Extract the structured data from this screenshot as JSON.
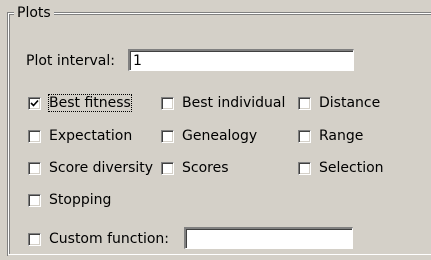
{
  "group": {
    "title": "Plots"
  },
  "plot_interval": {
    "label": "Plot interval:",
    "value": "1"
  },
  "checkboxes": [
    {
      "label": "Best fitness",
      "checked": true
    },
    {
      "label": "Best individual",
      "checked": false
    },
    {
      "label": "Distance",
      "checked": false
    },
    {
      "label": "Expectation",
      "checked": false
    },
    {
      "label": "Genealogy",
      "checked": false
    },
    {
      "label": "Range",
      "checked": false
    },
    {
      "label": "Score diversity",
      "checked": false
    },
    {
      "label": "Scores",
      "checked": false
    },
    {
      "label": "Selection",
      "checked": false
    },
    {
      "label": "Stopping",
      "checked": false
    }
  ],
  "custom_function": {
    "label": "Custom function:",
    "checked": false,
    "value": ""
  }
}
